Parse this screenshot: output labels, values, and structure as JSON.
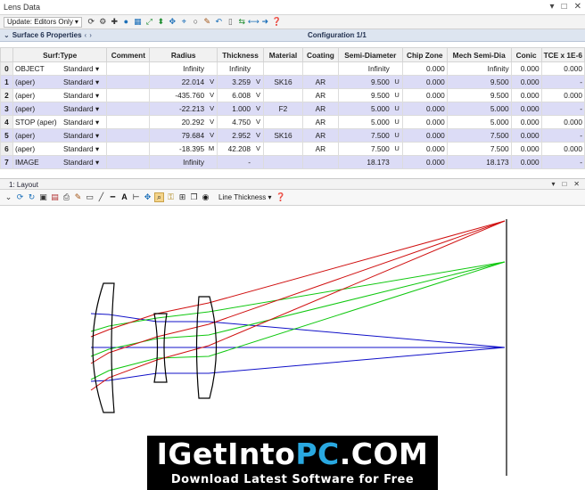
{
  "window": {
    "title": "Lens Data",
    "controls": [
      "▾",
      "□",
      "✕"
    ]
  },
  "toolbar": {
    "update_label": "Update: Editors Only",
    "icons": [
      "refresh-icon",
      "settings-icon",
      "add-icon",
      "globe-icon",
      "grid-icon",
      "scale-icon",
      "lens-icon",
      "move-icon",
      "circle-icon",
      "tool-icon",
      "undo-icon",
      "page-icon",
      "sync-icon",
      "double-arrow-icon",
      "right-arrow-icon",
      "help-icon"
    ]
  },
  "properties": {
    "surface_label": "Surface 6 Properties",
    "configuration_label": "Configuration 1/1"
  },
  "table": {
    "headers": [
      "",
      "Surf:Type",
      "Comment",
      "Radius",
      "Thickness",
      "Material",
      "Coating",
      "Semi-Diameter",
      "Chip Zone",
      "Mech Semi-Dia",
      "Conic",
      "TCE x 1E-6"
    ],
    "rows": [
      {
        "num": "0",
        "surf": "OBJECT",
        "type": "Standard",
        "comment": "",
        "radius": "Infinity",
        "rs": "",
        "thickness": "Infinity",
        "ts": "",
        "material": "",
        "coating": "",
        "semi": "Infinity",
        "ss": "",
        "chip": "0.000",
        "mech": "Infinity",
        "conic": "0.000",
        "tce": "0.000"
      },
      {
        "num": "1",
        "surf": "(aper)",
        "type": "Standard",
        "comment": "",
        "radius": "22.014",
        "rs": "V",
        "thickness": "3.259",
        "ts": "V",
        "material": "SK16",
        "coating": "AR",
        "semi": "9.500",
        "ss": "U",
        "chip": "0.000",
        "mech": "9.500",
        "conic": "0.000",
        "tce": "-"
      },
      {
        "num": "2",
        "surf": "(aper)",
        "type": "Standard",
        "comment": "",
        "radius": "-435.760",
        "rs": "V",
        "thickness": "6.008",
        "ts": "V",
        "material": "",
        "coating": "AR",
        "semi": "9.500",
        "ss": "U",
        "chip": "0.000",
        "mech": "9.500",
        "conic": "0.000",
        "tce": "0.000"
      },
      {
        "num": "3",
        "surf": "(aper)",
        "type": "Standard",
        "comment": "",
        "radius": "-22.213",
        "rs": "V",
        "thickness": "1.000",
        "ts": "V",
        "material": "F2",
        "coating": "AR",
        "semi": "5.000",
        "ss": "U",
        "chip": "0.000",
        "mech": "5.000",
        "conic": "0.000",
        "tce": "-"
      },
      {
        "num": "4",
        "surf": "STOP (aper)",
        "type": "Standard",
        "comment": "",
        "radius": "20.292",
        "rs": "V",
        "thickness": "4.750",
        "ts": "V",
        "material": "",
        "coating": "AR",
        "semi": "5.000",
        "ss": "U",
        "chip": "0.000",
        "mech": "5.000",
        "conic": "0.000",
        "tce": "0.000"
      },
      {
        "num": "5",
        "surf": "(aper)",
        "type": "Standard",
        "comment": "",
        "radius": "79.684",
        "rs": "V",
        "thickness": "2.952",
        "ts": "V",
        "material": "SK16",
        "coating": "AR",
        "semi": "7.500",
        "ss": "U",
        "chip": "0.000",
        "mech": "7.500",
        "conic": "0.000",
        "tce": "-"
      },
      {
        "num": "6",
        "surf": "(aper)",
        "type": "Standard",
        "comment": "",
        "radius": "-18.395",
        "rs": "M",
        "thickness": "42.208",
        "ts": "V",
        "material": "",
        "coating": "AR",
        "semi": "7.500",
        "ss": "U",
        "chip": "0.000",
        "mech": "7.500",
        "conic": "0.000",
        "tce": "0.000"
      },
      {
        "num": "7",
        "surf": "IMAGE",
        "type": "Standard",
        "comment": "",
        "radius": "Infinity",
        "rs": "",
        "thickness": "-",
        "ts": "",
        "material": "",
        "coating": "",
        "semi": "18.173",
        "ss": "",
        "chip": "0.000",
        "mech": "18.173",
        "conic": "0.000",
        "tce": "-"
      }
    ]
  },
  "layout": {
    "title": "1: Layout",
    "line_thickness_label": "Line Thickness",
    "controls": [
      "▾",
      "□",
      "✕"
    ],
    "colors": {
      "blue": "#1010c8",
      "green": "#10c810",
      "red": "#d01010",
      "lens": "#000000"
    }
  },
  "watermark": {
    "brand_white": "IGetInto",
    "brand_blue": "PC",
    "brand_tail": ".COM",
    "tagline": "Download Latest Software for Free"
  }
}
